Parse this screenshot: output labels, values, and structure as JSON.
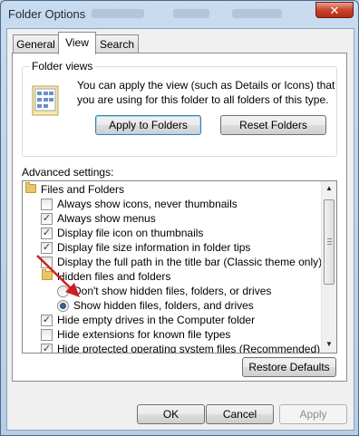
{
  "window": {
    "title": "Folder Options",
    "close_label": "✕"
  },
  "tabs": [
    {
      "label": "General",
      "active": false
    },
    {
      "label": "View",
      "active": true
    },
    {
      "label": "Search",
      "active": false
    }
  ],
  "folder_views": {
    "label": "Folder views",
    "description": "You can apply the view (such as Details or Icons) that you are using for this folder to all folders of this type.",
    "apply_button": "Apply to Folders",
    "reset_button": "Reset Folders"
  },
  "advanced": {
    "label": "Advanced settings:",
    "items": [
      {
        "type": "folder",
        "label": "Files and Folders"
      },
      {
        "type": "checkbox",
        "checked": false,
        "label": "Always show icons, never thumbnails"
      },
      {
        "type": "checkbox",
        "checked": true,
        "label": "Always show menus"
      },
      {
        "type": "checkbox",
        "checked": true,
        "label": "Display file icon on thumbnails"
      },
      {
        "type": "checkbox",
        "checked": true,
        "label": "Display file size information in folder tips"
      },
      {
        "type": "checkbox",
        "checked": false,
        "label": "Display the full path in the title bar (Classic theme only)"
      },
      {
        "type": "folder",
        "label": "Hidden files and folders"
      },
      {
        "type": "radio",
        "checked": false,
        "label": "Don't show hidden files, folders, or drives"
      },
      {
        "type": "radio",
        "checked": true,
        "label": "Show hidden files, folders, and drives"
      },
      {
        "type": "checkbox",
        "checked": true,
        "label": "Hide empty drives in the Computer folder"
      },
      {
        "type": "checkbox",
        "checked": false,
        "label": "Hide extensions for known file types"
      },
      {
        "type": "checkbox",
        "checked": true,
        "label": "Hide protected operating system files (Recommended)"
      }
    ],
    "restore_button": "Restore Defaults"
  },
  "dialog_buttons": {
    "ok": "OK",
    "cancel": "Cancel",
    "apply": "Apply"
  },
  "colors": {
    "annotation_arrow": "#cc1f1f",
    "check_mark": "#1f3b6b"
  },
  "icons": {
    "folder": "folder-icon",
    "close": "close-icon",
    "scroll_up": "scroll-up-icon",
    "scroll_down": "scroll-down-icon",
    "view_preview": "folder-views-icon"
  }
}
